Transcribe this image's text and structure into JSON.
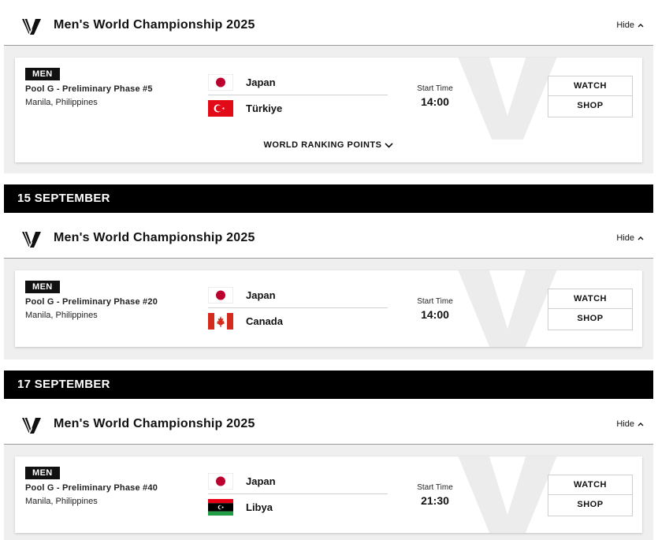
{
  "blocks": [
    {
      "competition": {
        "title": "Men's World Championship 2025",
        "hide_label": "Hide"
      },
      "match": {
        "gender_badge": "MEN",
        "phase": "Pool G - Preliminary Phase #5",
        "venue": "Manila, Philippines",
        "team1": {
          "name": "Japan",
          "flag": "japan-flag-icon"
        },
        "team2": {
          "name": "Türkiye",
          "flag": "turkiye-flag-icon"
        },
        "start_label": "Start Time",
        "start_time": "14:00",
        "watch_label": "WATCH",
        "shop_label": "SHOP",
        "ranking_points_label": "WORLD RANKING POINTS"
      }
    },
    {
      "date": "15 SEPTEMBER",
      "competition": {
        "title": "Men's World Championship 2025",
        "hide_label": "Hide"
      },
      "match": {
        "gender_badge": "MEN",
        "phase": "Pool G - Preliminary Phase #20",
        "venue": "Manila, Philippines",
        "team1": {
          "name": "Japan",
          "flag": "japan-flag-icon"
        },
        "team2": {
          "name": "Canada",
          "flag": "canada-flag-icon"
        },
        "start_label": "Start Time",
        "start_time": "14:00",
        "watch_label": "WATCH",
        "shop_label": "SHOP"
      }
    },
    {
      "date": "17 SEPTEMBER",
      "competition": {
        "title": "Men's World Championship 2025",
        "hide_label": "Hide"
      },
      "match": {
        "gender_badge": "MEN",
        "phase": "Pool G - Preliminary Phase #40",
        "venue": "Manila, Philippines",
        "team1": {
          "name": "Japan",
          "flag": "japan-flag-icon"
        },
        "team2": {
          "name": "Libya",
          "flag": "libya-flag-icon"
        },
        "start_label": "Start Time",
        "start_time": "21:30",
        "watch_label": "WATCH",
        "shop_label": "SHOP"
      }
    }
  ],
  "colors": {
    "header_bg": "#000000",
    "section_bg": "#efefef",
    "turkiye_red": "#e30a17",
    "canada_red": "#d52b1e",
    "japan_red": "#bc002d",
    "libya_green": "#239e46"
  }
}
